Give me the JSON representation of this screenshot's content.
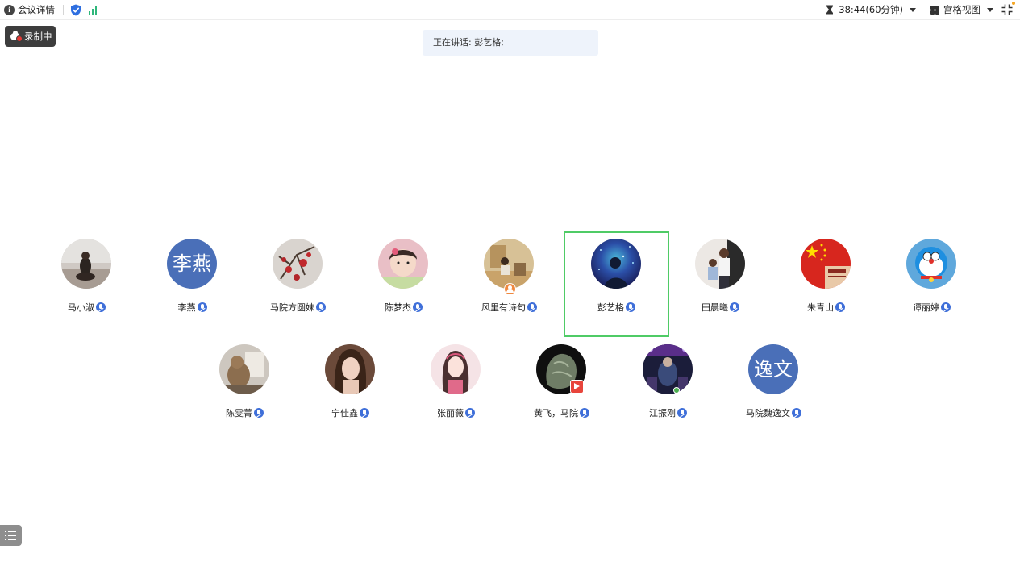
{
  "topbar": {
    "meeting_info_label": "会议详情",
    "timer": "38:44(60分钟)",
    "view_mode": "宫格视图"
  },
  "recording": {
    "label": "录制中"
  },
  "speaking": {
    "text": "正在讲话: 彭艺格;"
  },
  "colors": {
    "active_border": "#4fcb66",
    "mic_blue": "#3f6fd9",
    "text_avatar_bg": "#4a6fb8"
  },
  "participants": [
    {
      "name": "马小淑",
      "avatar_text": ""
    },
    {
      "name": "李燕",
      "avatar_text": "李燕"
    },
    {
      "name": "马院方圆妹",
      "avatar_text": ""
    },
    {
      "name": "陈梦杰",
      "avatar_text": ""
    },
    {
      "name": "风里有诗句",
      "avatar_text": "",
      "badge": "host"
    },
    {
      "name": "彭艺格",
      "avatar_text": "",
      "active": true
    },
    {
      "name": "田晨曦",
      "avatar_text": ""
    },
    {
      "name": "朱青山",
      "avatar_text": ""
    },
    {
      "name": "谭丽婷",
      "avatar_text": ""
    },
    {
      "name": "陈雯菁",
      "avatar_text": ""
    },
    {
      "name": "宁佳鑫",
      "avatar_text": ""
    },
    {
      "name": "张丽薇",
      "avatar_text": ""
    },
    {
      "name": "黄飞，马院",
      "avatar_text": "",
      "badge": "share"
    },
    {
      "name": "江振刚",
      "avatar_text": "",
      "badge": "online"
    },
    {
      "name": "马院魏逸文",
      "avatar_text": "逸文"
    }
  ]
}
